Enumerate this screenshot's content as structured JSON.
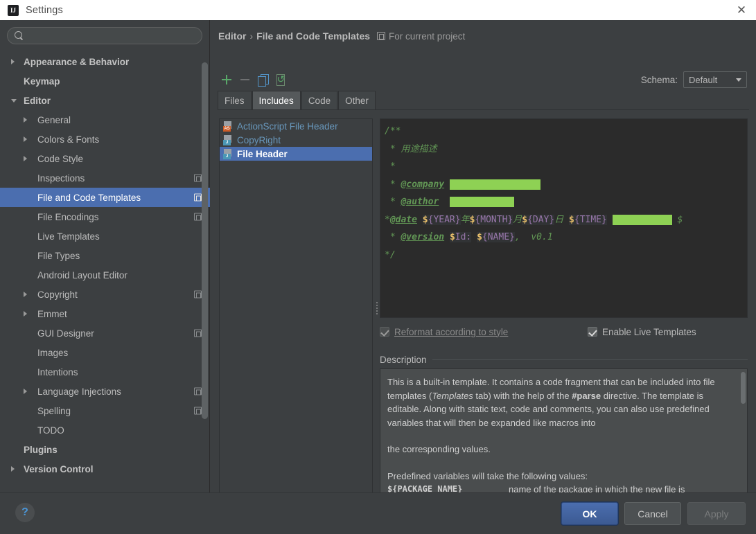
{
  "window": {
    "title": "Settings",
    "app_icon": "intellij-logo-icon",
    "close_icon": "close-icon"
  },
  "sidebar": {
    "search": {
      "value": "",
      "placeholder": "",
      "icon": "search-icon"
    },
    "items": [
      {
        "label": "Appearance & Behavior",
        "level": 0,
        "arrow": "right",
        "selected": false,
        "project_icon": false
      },
      {
        "label": "Keymap",
        "level": 0,
        "arrow": "none",
        "selected": false,
        "project_icon": false
      },
      {
        "label": "Editor",
        "level": 0,
        "arrow": "down",
        "selected": false,
        "project_icon": false
      },
      {
        "label": "General",
        "level": 1,
        "arrow": "right",
        "selected": false,
        "project_icon": false
      },
      {
        "label": "Colors & Fonts",
        "level": 1,
        "arrow": "right",
        "selected": false,
        "project_icon": false
      },
      {
        "label": "Code Style",
        "level": 1,
        "arrow": "right",
        "selected": false,
        "project_icon": false
      },
      {
        "label": "Inspections",
        "level": 1,
        "arrow": "none",
        "selected": false,
        "project_icon": true
      },
      {
        "label": "File and Code Templates",
        "level": 1,
        "arrow": "none",
        "selected": true,
        "project_icon": true
      },
      {
        "label": "File Encodings",
        "level": 1,
        "arrow": "none",
        "selected": false,
        "project_icon": true
      },
      {
        "label": "Live Templates",
        "level": 1,
        "arrow": "none",
        "selected": false,
        "project_icon": false
      },
      {
        "label": "File Types",
        "level": 1,
        "arrow": "none",
        "selected": false,
        "project_icon": false
      },
      {
        "label": "Android Layout Editor",
        "level": 1,
        "arrow": "none",
        "selected": false,
        "project_icon": false
      },
      {
        "label": "Copyright",
        "level": 1,
        "arrow": "right",
        "selected": false,
        "project_icon": true
      },
      {
        "label": "Emmet",
        "level": 1,
        "arrow": "right",
        "selected": false,
        "project_icon": false
      },
      {
        "label": "GUI Designer",
        "level": 1,
        "arrow": "none",
        "selected": false,
        "project_icon": true
      },
      {
        "label": "Images",
        "level": 1,
        "arrow": "none",
        "selected": false,
        "project_icon": false
      },
      {
        "label": "Intentions",
        "level": 1,
        "arrow": "none",
        "selected": false,
        "project_icon": false
      },
      {
        "label": "Language Injections",
        "level": 1,
        "arrow": "right",
        "selected": false,
        "project_icon": true
      },
      {
        "label": "Spelling",
        "level": 1,
        "arrow": "none",
        "selected": false,
        "project_icon": true
      },
      {
        "label": "TODO",
        "level": 1,
        "arrow": "none",
        "selected": false,
        "project_icon": false
      },
      {
        "label": "Plugins",
        "level": 0,
        "arrow": "none",
        "selected": false,
        "project_icon": false
      },
      {
        "label": "Version Control",
        "level": 0,
        "arrow": "right",
        "selected": false,
        "project_icon": false
      }
    ]
  },
  "breadcrumb": {
    "parent": "Editor",
    "separator": "›",
    "current": "File and Code Templates",
    "scope_icon": "project-scope-icon",
    "scope_label": "For current project"
  },
  "toolbar": {
    "add_icon": "plus-icon",
    "remove_icon": "minus-icon",
    "copy_icon": "copy-icon",
    "reset_icon": "reset-icon"
  },
  "schema": {
    "label": "Schema:",
    "value": "Default",
    "caret_icon": "chevron-down-icon"
  },
  "tabs": [
    {
      "label": "Files",
      "active": false
    },
    {
      "label": "Includes",
      "active": true
    },
    {
      "label": "Code",
      "active": false
    },
    {
      "label": "Other",
      "active": false
    }
  ],
  "template_list": [
    {
      "label": "ActionScript File Header",
      "badge": "AS",
      "badge_color": "#cc5b26",
      "selected": false
    },
    {
      "label": "CopyRight",
      "badge": "J",
      "badge_color": "#4b97b5",
      "selected": false
    },
    {
      "label": "File Header",
      "badge": "J",
      "badge_color": "#4b97b5",
      "selected": true
    }
  ],
  "editor": {
    "lines": [
      [
        {
          "t": "comment",
          "v": "/**"
        }
      ],
      [
        {
          "t": "comment",
          "v": " * 用途描述"
        }
      ],
      [
        {
          "t": "comment",
          "v": " *"
        }
      ],
      [
        {
          "t": "comment",
          "v": " * "
        },
        {
          "t": "tag",
          "v": "@company"
        },
        {
          "t": "comment",
          "v": " "
        },
        {
          "t": "redact",
          "v": "",
          "width": 131
        }
      ],
      [
        {
          "t": "comment",
          "v": " * "
        },
        {
          "t": "tag",
          "v": "@author"
        },
        {
          "t": "comment",
          "v": "  "
        },
        {
          "t": "redact",
          "v": "",
          "width": 93
        }
      ],
      [
        {
          "t": "comment",
          "v": "*"
        },
        {
          "t": "tag",
          "v": "@date"
        },
        {
          "t": "comment",
          "v": " "
        },
        {
          "t": "dollar",
          "v": "$"
        },
        {
          "t": "var",
          "v": "{YEAR}"
        },
        {
          "t": "comment",
          "v": "年"
        },
        {
          "t": "dollar",
          "v": "$"
        },
        {
          "t": "var",
          "v": "{MONTH}"
        },
        {
          "t": "comment",
          "v": "月"
        },
        {
          "t": "dollar",
          "v": "$"
        },
        {
          "t": "var",
          "v": "{DAY}"
        },
        {
          "t": "comment",
          "v": "日 "
        },
        {
          "t": "dollar",
          "v": "$"
        },
        {
          "t": "var",
          "v": "{TIME}"
        },
        {
          "t": "comment",
          "v": " "
        },
        {
          "t": "redact",
          "v": "",
          "width": 86
        },
        {
          "t": "comment",
          "v": " $"
        }
      ],
      [
        {
          "t": "comment",
          "v": " * "
        },
        {
          "t": "tag",
          "v": "@version"
        },
        {
          "t": "comment",
          "v": " "
        },
        {
          "t": "dollar",
          "v": "$"
        },
        {
          "t": "var",
          "v": "Id:"
        },
        {
          "t": "comment",
          "v": " "
        },
        {
          "t": "dollar",
          "v": "$"
        },
        {
          "t": "var",
          "v": "{NAME}"
        },
        {
          "t": "comment",
          "v": ",  v0.1"
        }
      ],
      [
        {
          "t": "comment",
          "v": "*/"
        }
      ]
    ]
  },
  "options": {
    "reformat": {
      "label": "Reformat according to style",
      "checked": true,
      "enabled": false
    },
    "live_templates": {
      "label": "Enable Live Templates",
      "checked": true,
      "enabled": true
    }
  },
  "description": {
    "title": "Description",
    "paragraph1_a": "This is a built-in template. It contains a code fragment that can be included into file templates (",
    "paragraph1_em": "Templates",
    "paragraph1_b": " tab) with the help of the ",
    "paragraph1_bold": "#parse",
    "paragraph1_c": " directive. The template is editable. Along with static text, code and comments, you can also use predefined variables that will then be expanded like macros into",
    "paragraph2": "the corresponding values.",
    "paragraph3": "Predefined variables will take the following values:",
    "variable_name": "${PACKAGE_NAME}",
    "variable_desc": "name of the package in which the new file is"
  },
  "footer": {
    "help_label": "?",
    "ok_label": "OK",
    "cancel_label": "Cancel",
    "apply_label": "Apply"
  }
}
